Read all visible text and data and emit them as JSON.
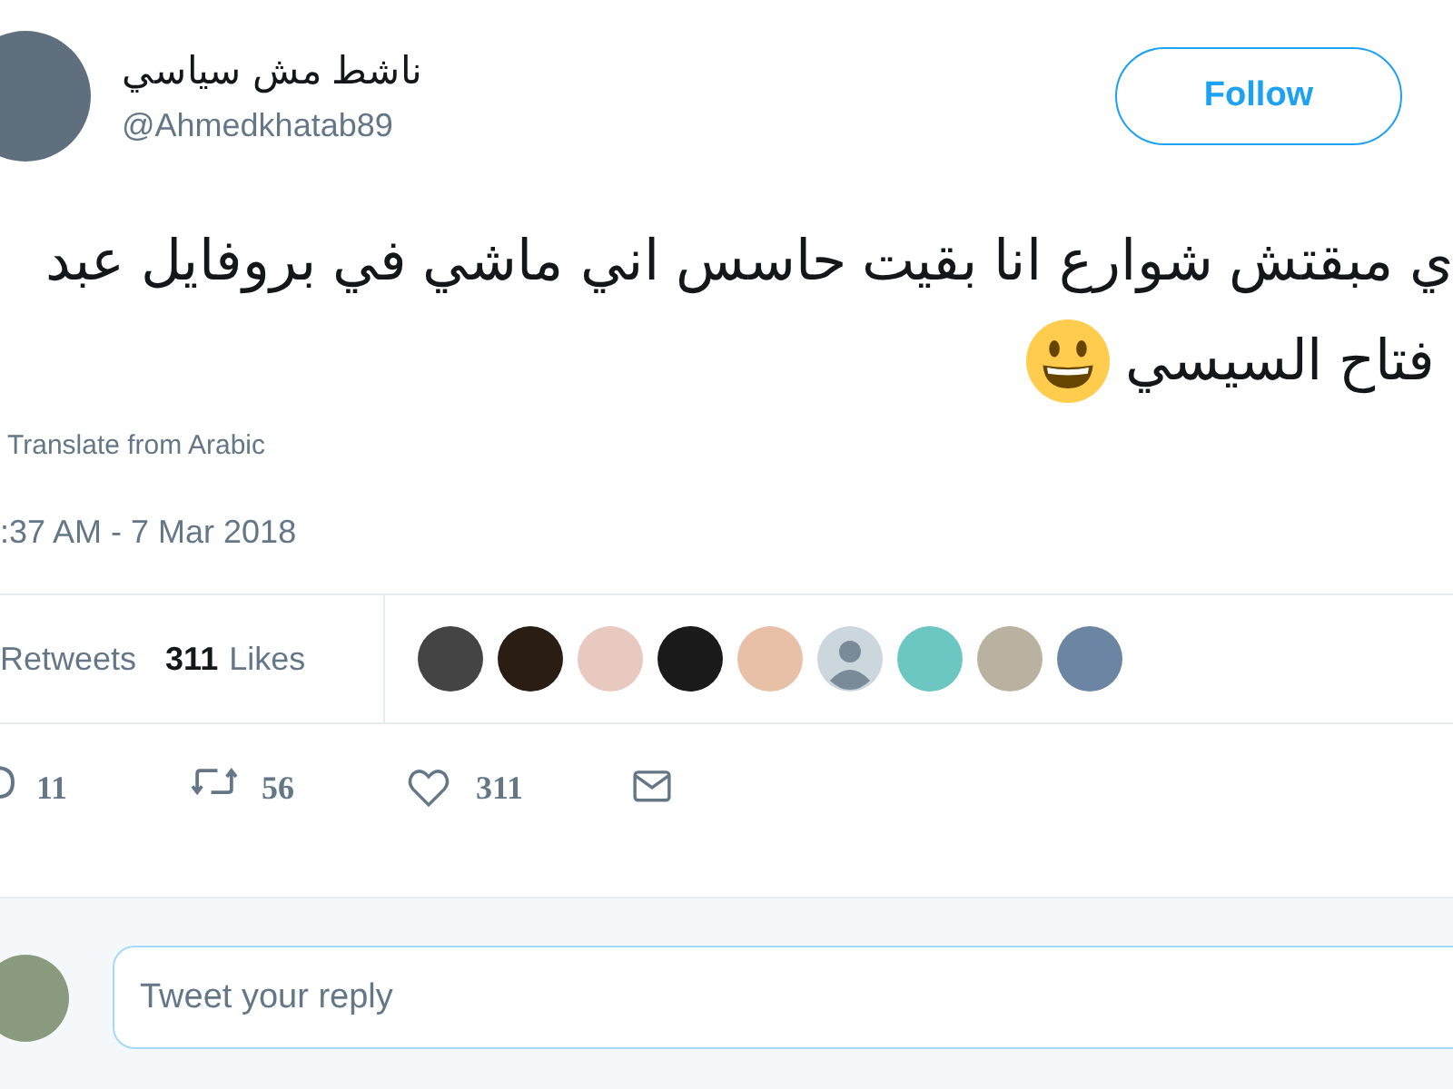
{
  "tweet": {
    "author": {
      "name": "ناشط مش سياسي",
      "handle": "@Ahmedkhatab89"
    },
    "follow_button": "Follow",
    "text_lines": [
      "ي مبقتش شوارع انا بقيت حاسس اني ماشي في بروفايل عبد",
      "فتاح السيسي"
    ],
    "translate_link": "Translate from Arabic",
    "timestamp": ":37 AM - 7 Mar 2018",
    "stats": [
      {
        "label": "Retweets"
      },
      {
        "count": "311",
        "label": "Likes"
      }
    ],
    "likers": [
      {
        "kind": "photo"
      },
      {
        "kind": "photo"
      },
      {
        "kind": "photo"
      },
      {
        "kind": "photo"
      },
      {
        "kind": "photo"
      },
      {
        "kind": "default"
      },
      {
        "kind": "photo"
      },
      {
        "kind": "photo"
      },
      {
        "kind": "photo"
      }
    ],
    "actions": [
      {
        "kind": "reply",
        "count": "11"
      },
      {
        "kind": "retweet",
        "count": "56"
      },
      {
        "kind": "like",
        "count": "311"
      },
      {
        "kind": "message"
      }
    ]
  },
  "reply_box": {
    "placeholder": "Tweet your reply"
  }
}
